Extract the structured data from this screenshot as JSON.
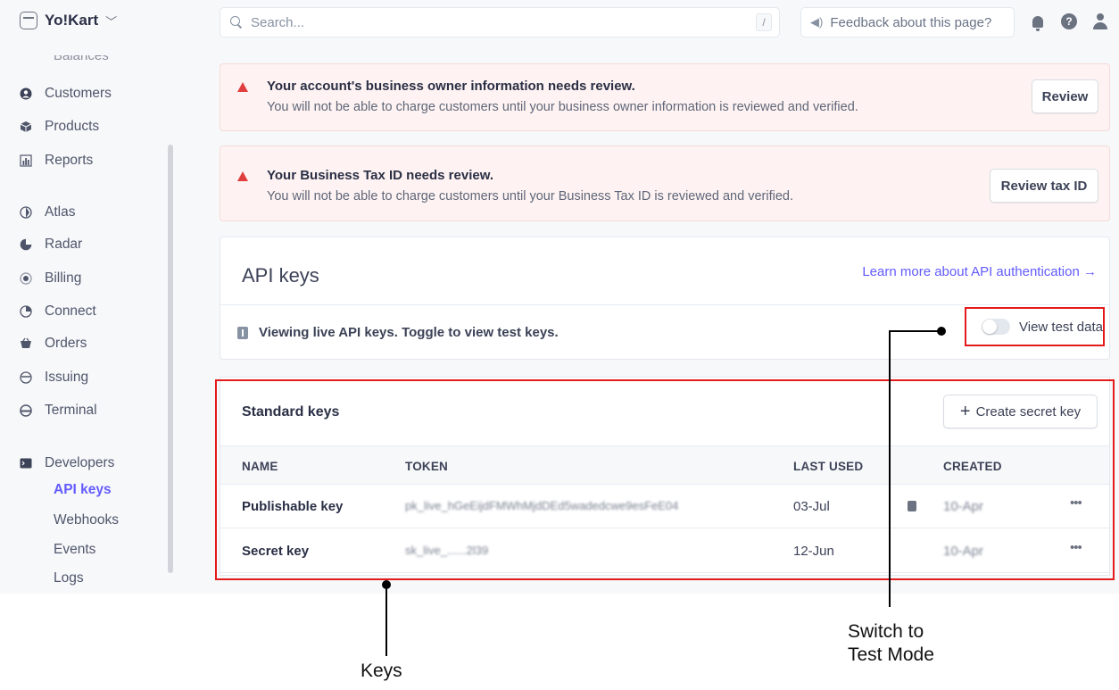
{
  "header": {
    "account_name": "Yo!Kart",
    "search_placeholder": "Search...",
    "search_shortcut": "/",
    "feedback_label": "Feedback about this page?"
  },
  "sidebar": {
    "partial_item": "Balances",
    "items": [
      {
        "label": "Customers",
        "icon": "user-icon"
      },
      {
        "label": "Products",
        "icon": "box-icon"
      },
      {
        "label": "Reports",
        "icon": "bar-chart-icon"
      },
      {
        "label": "Atlas",
        "icon": "atlas-icon"
      },
      {
        "label": "Radar",
        "icon": "radar-icon"
      },
      {
        "label": "Billing",
        "icon": "billing-icon"
      },
      {
        "label": "Connect",
        "icon": "connect-icon"
      },
      {
        "label": "Orders",
        "icon": "orders-icon"
      },
      {
        "label": "Issuing",
        "icon": "card-icon"
      },
      {
        "label": "Terminal",
        "icon": "terminal-icon"
      },
      {
        "label": "Developers",
        "icon": "developers-icon"
      }
    ],
    "developer_subitems": [
      "API keys",
      "Webhooks",
      "Events",
      "Logs"
    ],
    "active_subitem": "API keys"
  },
  "alerts": [
    {
      "title": "Your account's business owner information needs review.",
      "body": "You will not be able to charge customers until your business owner information is reviewed and verified.",
      "button": "Review"
    },
    {
      "title": "Your Business Tax ID needs review.",
      "body": "You will not be able to charge customers until your Business Tax ID is reviewed and verified.",
      "button": "Review tax ID"
    }
  ],
  "api_keys": {
    "title": "API keys",
    "learn_more": "Learn more about API authentication →",
    "viewing_notice": "Viewing live API keys. Toggle to view test keys.",
    "toggle_label": "View test data",
    "toggle_on": false
  },
  "standard_keys": {
    "title": "Standard keys",
    "create_button": "Create secret key",
    "columns": [
      "NAME",
      "TOKEN",
      "LAST USED",
      "CREATED"
    ],
    "rows": [
      {
        "name": "Publishable key",
        "token": "pk_live_hGeEijdFMWhMjdDEd5wadedcwe9esFeE04",
        "last_used": "03-Jul",
        "created": "10-Apr"
      },
      {
        "name": "Secret key",
        "token": "sk_live_......2l39",
        "last_used": "12-Jun",
        "created": "10-Apr"
      }
    ]
  },
  "annotations": {
    "keys_label": "Keys",
    "switch_label_line1": "Switch to",
    "switch_label_line2": "Test Mode"
  },
  "colors": {
    "accent": "#635bff",
    "alert_bg": "#fef3f2",
    "alert_icon": "#e03e3e",
    "annotation": "#e31b1b"
  }
}
